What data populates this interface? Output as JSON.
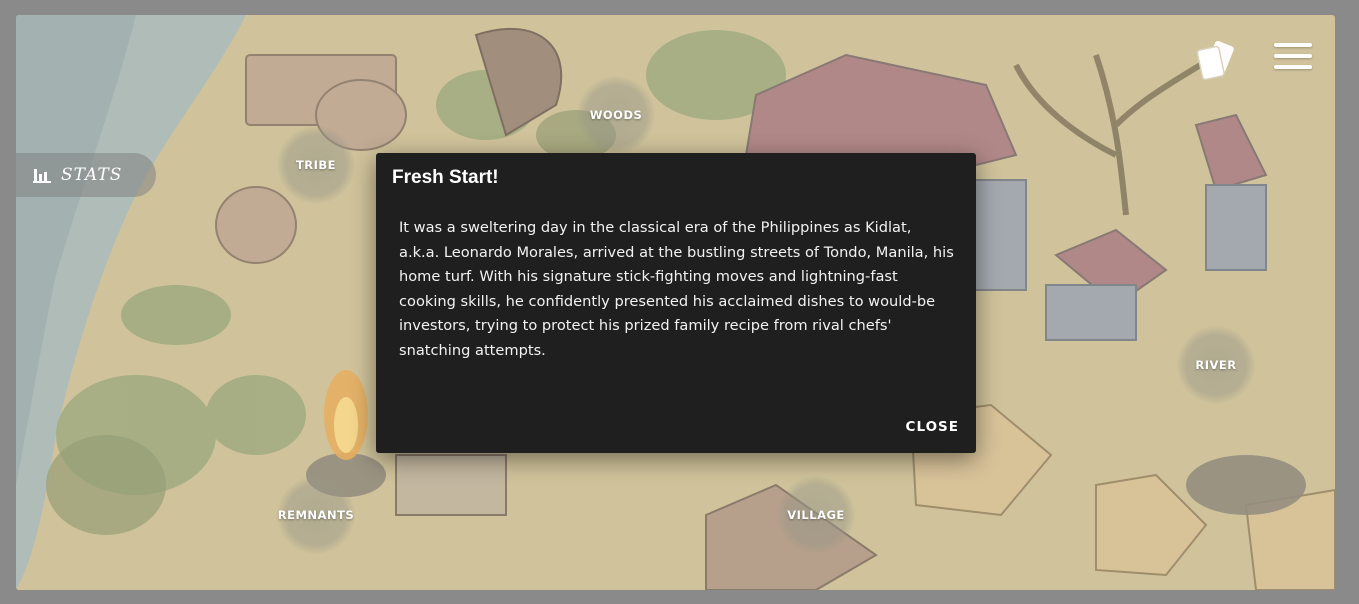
{
  "map": {
    "locations": [
      {
        "id": "woods",
        "label": "WOODS"
      },
      {
        "id": "tribe",
        "label": "TRIBE"
      },
      {
        "id": "river",
        "label": "RIVER"
      },
      {
        "id": "remnants",
        "label": "REMNANTS"
      },
      {
        "id": "village",
        "label": "VILLAGE"
      }
    ]
  },
  "sidebar": {
    "stats_label": "STATS",
    "stats_icon": "bar-chart-icon"
  },
  "topbar": {
    "cards_icon": "cards-icon",
    "menu_icon": "hamburger-menu-icon"
  },
  "dialog": {
    "title": "Fresh Start!",
    "body": "It was a sweltering day in the classical era of the Philippines as Kidlat, a.k.a. Leonardo Morales, arrived at the bustling streets of Tondo, Manila, his home turf. With his signature stick-fighting moves and lightning-fast cooking skills, he confidently presented his acclaimed dishes to would-be investors, trying to protect his prized family recipe from rival chefs' snatching attempts.",
    "close_label": "CLOSE"
  },
  "colors": {
    "dialog_bg": "#1f1f1f",
    "page_bg": "#8a8a8a",
    "water": "#9fb1b3",
    "ground": "#c9bb8c"
  }
}
